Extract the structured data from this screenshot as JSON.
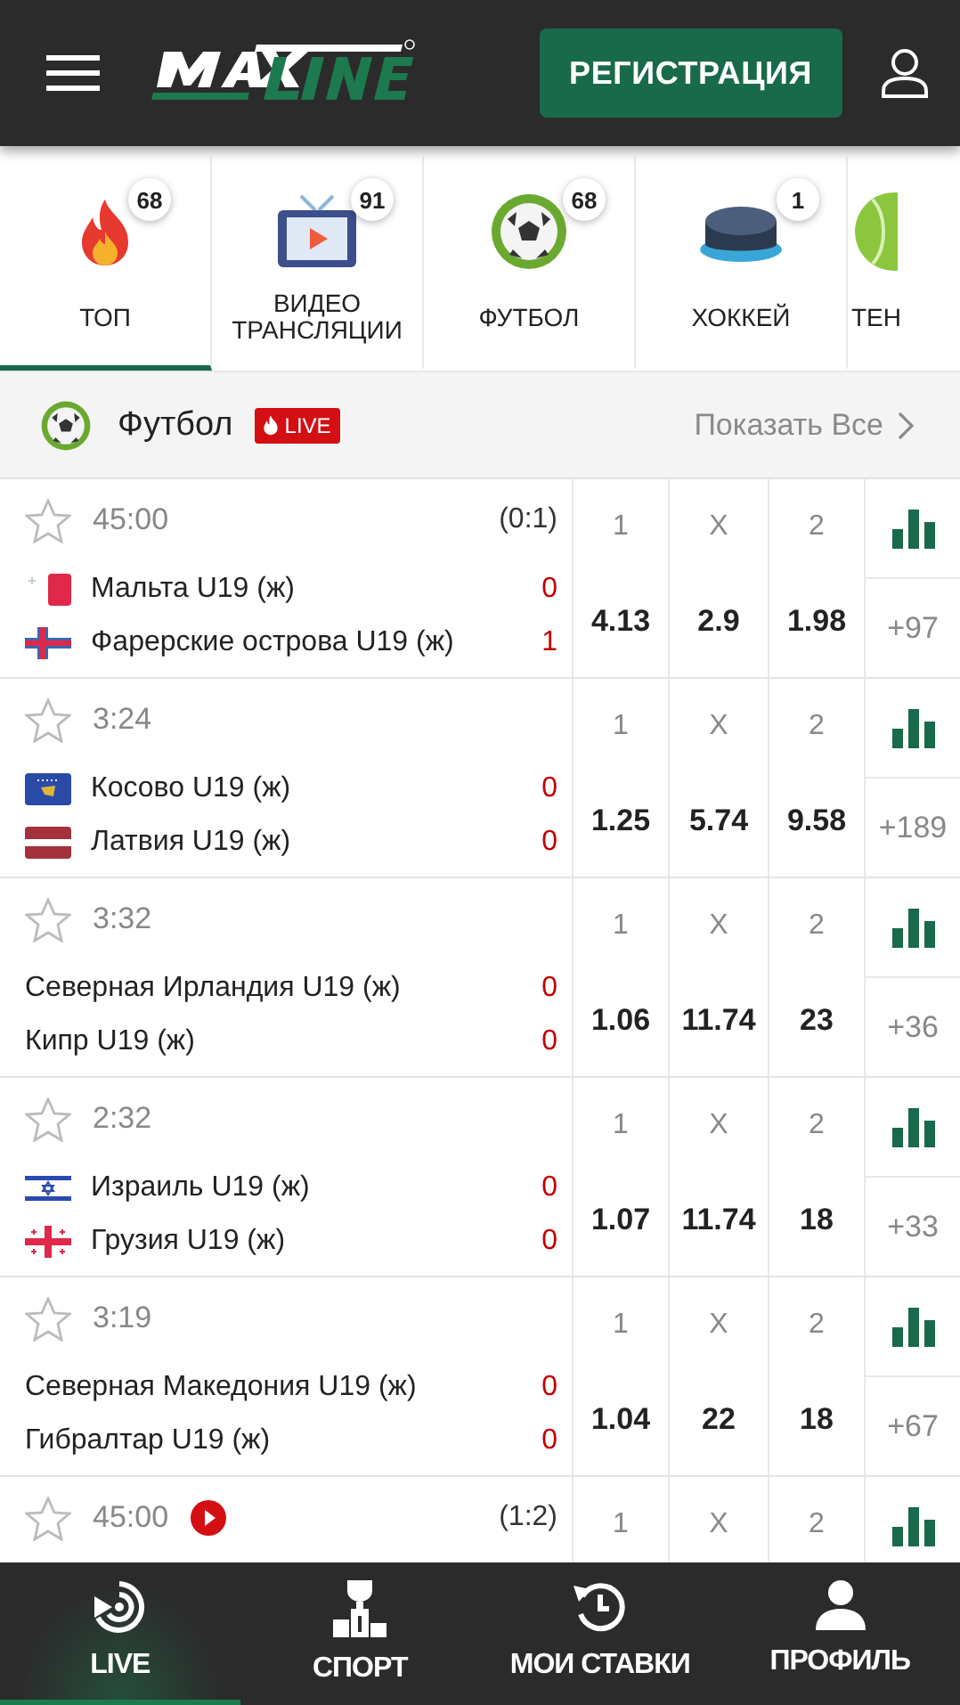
{
  "header": {
    "register_button": "РЕГИСТРАЦИЯ"
  },
  "sports": [
    {
      "kind": "fire",
      "label": "ТОП",
      "count": "68",
      "selected": true
    },
    {
      "kind": "tv",
      "label": "ВИДЕО ТРАНСЛЯЦИИ",
      "count": "91",
      "selected": false
    },
    {
      "kind": "football",
      "label": "ФУТБОЛ",
      "count": "68",
      "selected": false
    },
    {
      "kind": "hockey",
      "label": "ХОККЕЙ",
      "count": "1",
      "selected": false
    },
    {
      "kind": "tennis",
      "label": "ТЕН",
      "selected": false
    }
  ],
  "section": {
    "title": "Футбол",
    "live_badge": "LIVE",
    "show_all": "Показать Все"
  },
  "matches": [
    {
      "time": "45:00",
      "score": "(0:1)",
      "teams": [
        {
          "name": "Мальта U19 (ж)",
          "kind": "malta",
          "goals": "0"
        },
        {
          "name": "Фарерские острова U19 (ж)",
          "kind": "faroe",
          "goals": "1"
        }
      ],
      "odds": [
        {
          "label": "1",
          "value": "4.13"
        },
        {
          "label": "X",
          "value": "2.9"
        },
        {
          "label": "2",
          "value": "1.98"
        }
      ],
      "more": "+97"
    },
    {
      "time": "3:24",
      "teams": [
        {
          "name": "Косово U19 (ж)",
          "kind": "kosovo",
          "goals": "0"
        },
        {
          "name": "Латвия U19 (ж)",
          "kind": "latvia",
          "goals": "0"
        }
      ],
      "odds": [
        {
          "label": "1",
          "value": "1.25"
        },
        {
          "label": "X",
          "value": "5.74"
        },
        {
          "label": "2",
          "value": "9.58"
        }
      ],
      "more": "+189"
    },
    {
      "time": "3:32",
      "teams": [
        {
          "name": "Северная Ирландия U19 (ж)",
          "kind": "plain",
          "goals": "0"
        },
        {
          "name": "Кипр U19 (ж)",
          "kind": "plain",
          "goals": "0"
        }
      ],
      "odds": [
        {
          "label": "1",
          "value": "1.06"
        },
        {
          "label": "X",
          "value": "11.74"
        },
        {
          "label": "2",
          "value": "23"
        }
      ],
      "more": "+36"
    },
    {
      "time": "2:32",
      "teams": [
        {
          "name": "Израиль U19 (ж)",
          "kind": "israel",
          "goals": "0"
        },
        {
          "name": "Грузия U19 (ж)",
          "kind": "georgia",
          "goals": "0"
        }
      ],
      "odds": [
        {
          "label": "1",
          "value": "1.07"
        },
        {
          "label": "X",
          "value": "11.74"
        },
        {
          "label": "2",
          "value": "18"
        }
      ],
      "more": "+33"
    },
    {
      "time": "3:19",
      "teams": [
        {
          "name": "Северная Македония U19 (ж)",
          "kind": "plain",
          "goals": "0"
        },
        {
          "name": "Гибралтар U19 (ж)",
          "kind": "plain",
          "goals": "0"
        }
      ],
      "odds": [
        {
          "label": "1",
          "value": "1.04"
        },
        {
          "label": "X",
          "value": "22"
        },
        {
          "label": "2",
          "value": "18"
        }
      ],
      "more": "+67"
    },
    {
      "time": "45:00",
      "score": "(1:2)",
      "video": true,
      "odds": [
        {
          "label": "1"
        },
        {
          "label": "X"
        },
        {
          "label": "2"
        }
      ]
    }
  ],
  "nav": [
    {
      "kind": "live",
      "label": "LIVE",
      "selected": true
    },
    {
      "kind": "sport",
      "label": "СПОРТ",
      "selected": false
    },
    {
      "kind": "bets",
      "label": "МОИ СТАВКИ",
      "selected": false
    },
    {
      "kind": "profile",
      "label": "ПРОФИЛЬ",
      "selected": false
    }
  ]
}
